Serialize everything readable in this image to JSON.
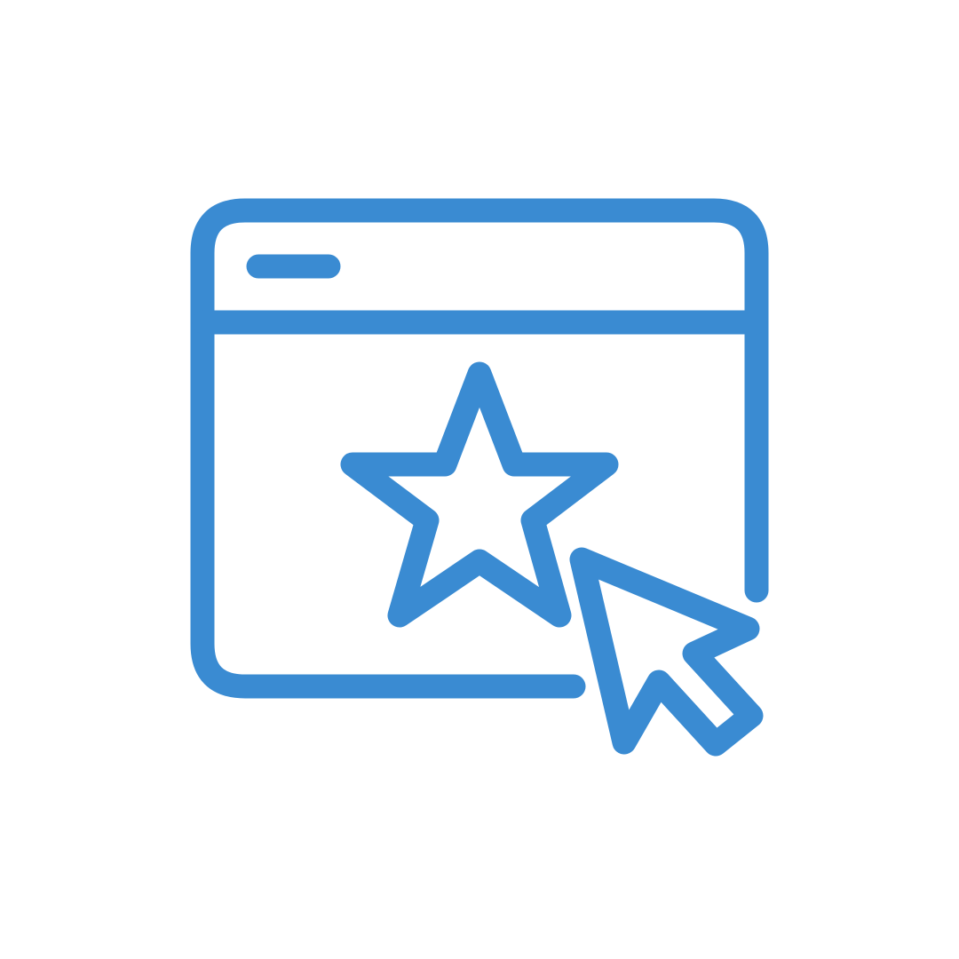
{
  "icon": {
    "name": "favorite-webpage-click-icon",
    "stroke_color": "#3a8bd2",
    "background_color": "#ffffff"
  }
}
